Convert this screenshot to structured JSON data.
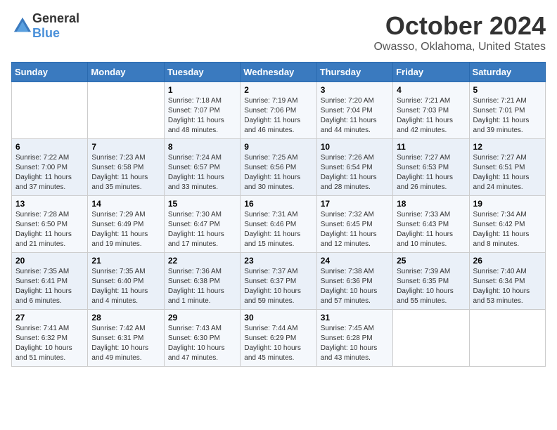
{
  "logo": {
    "general": "General",
    "blue": "Blue"
  },
  "title": "October 2024",
  "location": "Owasso, Oklahoma, United States",
  "days_of_week": [
    "Sunday",
    "Monday",
    "Tuesday",
    "Wednesday",
    "Thursday",
    "Friday",
    "Saturday"
  ],
  "weeks": [
    [
      {
        "day": "",
        "sunrise": "",
        "sunset": "",
        "daylight": ""
      },
      {
        "day": "",
        "sunrise": "",
        "sunset": "",
        "daylight": ""
      },
      {
        "day": "1",
        "sunrise": "Sunrise: 7:18 AM",
        "sunset": "Sunset: 7:07 PM",
        "daylight": "Daylight: 11 hours and 48 minutes."
      },
      {
        "day": "2",
        "sunrise": "Sunrise: 7:19 AM",
        "sunset": "Sunset: 7:06 PM",
        "daylight": "Daylight: 11 hours and 46 minutes."
      },
      {
        "day": "3",
        "sunrise": "Sunrise: 7:20 AM",
        "sunset": "Sunset: 7:04 PM",
        "daylight": "Daylight: 11 hours and 44 minutes."
      },
      {
        "day": "4",
        "sunrise": "Sunrise: 7:21 AM",
        "sunset": "Sunset: 7:03 PM",
        "daylight": "Daylight: 11 hours and 42 minutes."
      },
      {
        "day": "5",
        "sunrise": "Sunrise: 7:21 AM",
        "sunset": "Sunset: 7:01 PM",
        "daylight": "Daylight: 11 hours and 39 minutes."
      }
    ],
    [
      {
        "day": "6",
        "sunrise": "Sunrise: 7:22 AM",
        "sunset": "Sunset: 7:00 PM",
        "daylight": "Daylight: 11 hours and 37 minutes."
      },
      {
        "day": "7",
        "sunrise": "Sunrise: 7:23 AM",
        "sunset": "Sunset: 6:58 PM",
        "daylight": "Daylight: 11 hours and 35 minutes."
      },
      {
        "day": "8",
        "sunrise": "Sunrise: 7:24 AM",
        "sunset": "Sunset: 6:57 PM",
        "daylight": "Daylight: 11 hours and 33 minutes."
      },
      {
        "day": "9",
        "sunrise": "Sunrise: 7:25 AM",
        "sunset": "Sunset: 6:56 PM",
        "daylight": "Daylight: 11 hours and 30 minutes."
      },
      {
        "day": "10",
        "sunrise": "Sunrise: 7:26 AM",
        "sunset": "Sunset: 6:54 PM",
        "daylight": "Daylight: 11 hours and 28 minutes."
      },
      {
        "day": "11",
        "sunrise": "Sunrise: 7:27 AM",
        "sunset": "Sunset: 6:53 PM",
        "daylight": "Daylight: 11 hours and 26 minutes."
      },
      {
        "day": "12",
        "sunrise": "Sunrise: 7:27 AM",
        "sunset": "Sunset: 6:51 PM",
        "daylight": "Daylight: 11 hours and 24 minutes."
      }
    ],
    [
      {
        "day": "13",
        "sunrise": "Sunrise: 7:28 AM",
        "sunset": "Sunset: 6:50 PM",
        "daylight": "Daylight: 11 hours and 21 minutes."
      },
      {
        "day": "14",
        "sunrise": "Sunrise: 7:29 AM",
        "sunset": "Sunset: 6:49 PM",
        "daylight": "Daylight: 11 hours and 19 minutes."
      },
      {
        "day": "15",
        "sunrise": "Sunrise: 7:30 AM",
        "sunset": "Sunset: 6:47 PM",
        "daylight": "Daylight: 11 hours and 17 minutes."
      },
      {
        "day": "16",
        "sunrise": "Sunrise: 7:31 AM",
        "sunset": "Sunset: 6:46 PM",
        "daylight": "Daylight: 11 hours and 15 minutes."
      },
      {
        "day": "17",
        "sunrise": "Sunrise: 7:32 AM",
        "sunset": "Sunset: 6:45 PM",
        "daylight": "Daylight: 11 hours and 12 minutes."
      },
      {
        "day": "18",
        "sunrise": "Sunrise: 7:33 AM",
        "sunset": "Sunset: 6:43 PM",
        "daylight": "Daylight: 11 hours and 10 minutes."
      },
      {
        "day": "19",
        "sunrise": "Sunrise: 7:34 AM",
        "sunset": "Sunset: 6:42 PM",
        "daylight": "Daylight: 11 hours and 8 minutes."
      }
    ],
    [
      {
        "day": "20",
        "sunrise": "Sunrise: 7:35 AM",
        "sunset": "Sunset: 6:41 PM",
        "daylight": "Daylight: 11 hours and 6 minutes."
      },
      {
        "day": "21",
        "sunrise": "Sunrise: 7:35 AM",
        "sunset": "Sunset: 6:40 PM",
        "daylight": "Daylight: 11 hours and 4 minutes."
      },
      {
        "day": "22",
        "sunrise": "Sunrise: 7:36 AM",
        "sunset": "Sunset: 6:38 PM",
        "daylight": "Daylight: 11 hours and 1 minute."
      },
      {
        "day": "23",
        "sunrise": "Sunrise: 7:37 AM",
        "sunset": "Sunset: 6:37 PM",
        "daylight": "Daylight: 10 hours and 59 minutes."
      },
      {
        "day": "24",
        "sunrise": "Sunrise: 7:38 AM",
        "sunset": "Sunset: 6:36 PM",
        "daylight": "Daylight: 10 hours and 57 minutes."
      },
      {
        "day": "25",
        "sunrise": "Sunrise: 7:39 AM",
        "sunset": "Sunset: 6:35 PM",
        "daylight": "Daylight: 10 hours and 55 minutes."
      },
      {
        "day": "26",
        "sunrise": "Sunrise: 7:40 AM",
        "sunset": "Sunset: 6:34 PM",
        "daylight": "Daylight: 10 hours and 53 minutes."
      }
    ],
    [
      {
        "day": "27",
        "sunrise": "Sunrise: 7:41 AM",
        "sunset": "Sunset: 6:32 PM",
        "daylight": "Daylight: 10 hours and 51 minutes."
      },
      {
        "day": "28",
        "sunrise": "Sunrise: 7:42 AM",
        "sunset": "Sunset: 6:31 PM",
        "daylight": "Daylight: 10 hours and 49 minutes."
      },
      {
        "day": "29",
        "sunrise": "Sunrise: 7:43 AM",
        "sunset": "Sunset: 6:30 PM",
        "daylight": "Daylight: 10 hours and 47 minutes."
      },
      {
        "day": "30",
        "sunrise": "Sunrise: 7:44 AM",
        "sunset": "Sunset: 6:29 PM",
        "daylight": "Daylight: 10 hours and 45 minutes."
      },
      {
        "day": "31",
        "sunrise": "Sunrise: 7:45 AM",
        "sunset": "Sunset: 6:28 PM",
        "daylight": "Daylight: 10 hours and 43 minutes."
      },
      {
        "day": "",
        "sunrise": "",
        "sunset": "",
        "daylight": ""
      },
      {
        "day": "",
        "sunrise": "",
        "sunset": "",
        "daylight": ""
      }
    ]
  ]
}
